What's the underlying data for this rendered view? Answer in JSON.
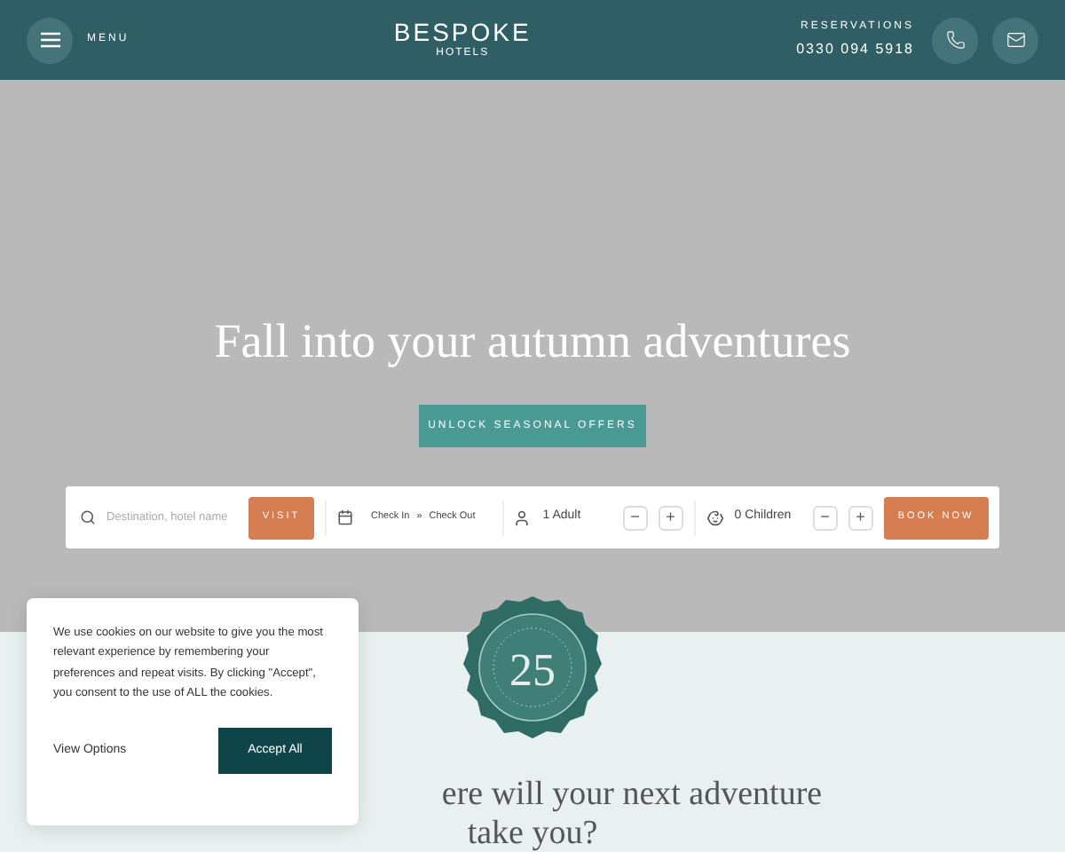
{
  "header": {
    "menu_label": "MENU",
    "logo": {
      "name": "BESPOKE",
      "sub": "HOTELS"
    },
    "reservations_label": "RESERVATIONS",
    "phone": "0330 094 5918"
  },
  "hero": {
    "title": "Fall into your autumn adventures",
    "cta": "UNLOCK SEASONAL OFFERS"
  },
  "booking": {
    "search_placeholder": "Destination, hotel name",
    "visit": "VISIT",
    "check_in": "Check In",
    "separator": "»",
    "check_out": "Check Out",
    "adults": "1 Adult",
    "children": "0 Children",
    "minus": "−",
    "plus": "+",
    "book": "BOOK NOW"
  },
  "seal": {
    "number": "25"
  },
  "section": {
    "heading_lines": [
      "ere will your next adventure",
      "take you?"
    ]
  },
  "cookie": {
    "text": "We use cookies on our website to give you the most relevant experience by remembering your preferences and repeat visits. By clicking \"Accept\", you consent to the use of ALL the cookies.",
    "view_options": "View Options",
    "accept": "Accept All"
  }
}
